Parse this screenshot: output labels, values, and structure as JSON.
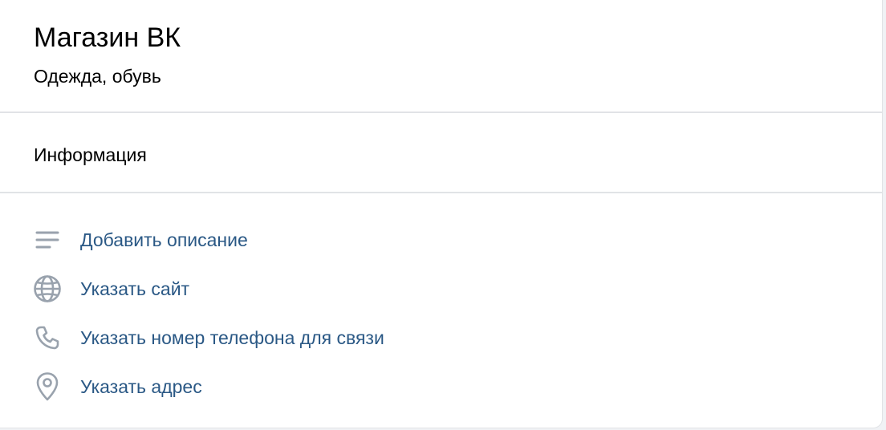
{
  "header": {
    "title": "Магазин ВК",
    "subtitle": "Одежда, обувь"
  },
  "info_section": {
    "title": "Информация"
  },
  "actions": [
    {
      "label": "Добавить описание",
      "icon": "text-lines-icon"
    },
    {
      "label": "Указать сайт",
      "icon": "globe-icon"
    },
    {
      "label": "Указать номер телефона для связи",
      "icon": "phone-icon"
    },
    {
      "label": "Указать адрес",
      "icon": "location-pin-icon"
    }
  ],
  "colors": {
    "link": "#2a5885",
    "icon": "#99a2ad",
    "divider": "#e1e3e6",
    "text": "#000000"
  }
}
